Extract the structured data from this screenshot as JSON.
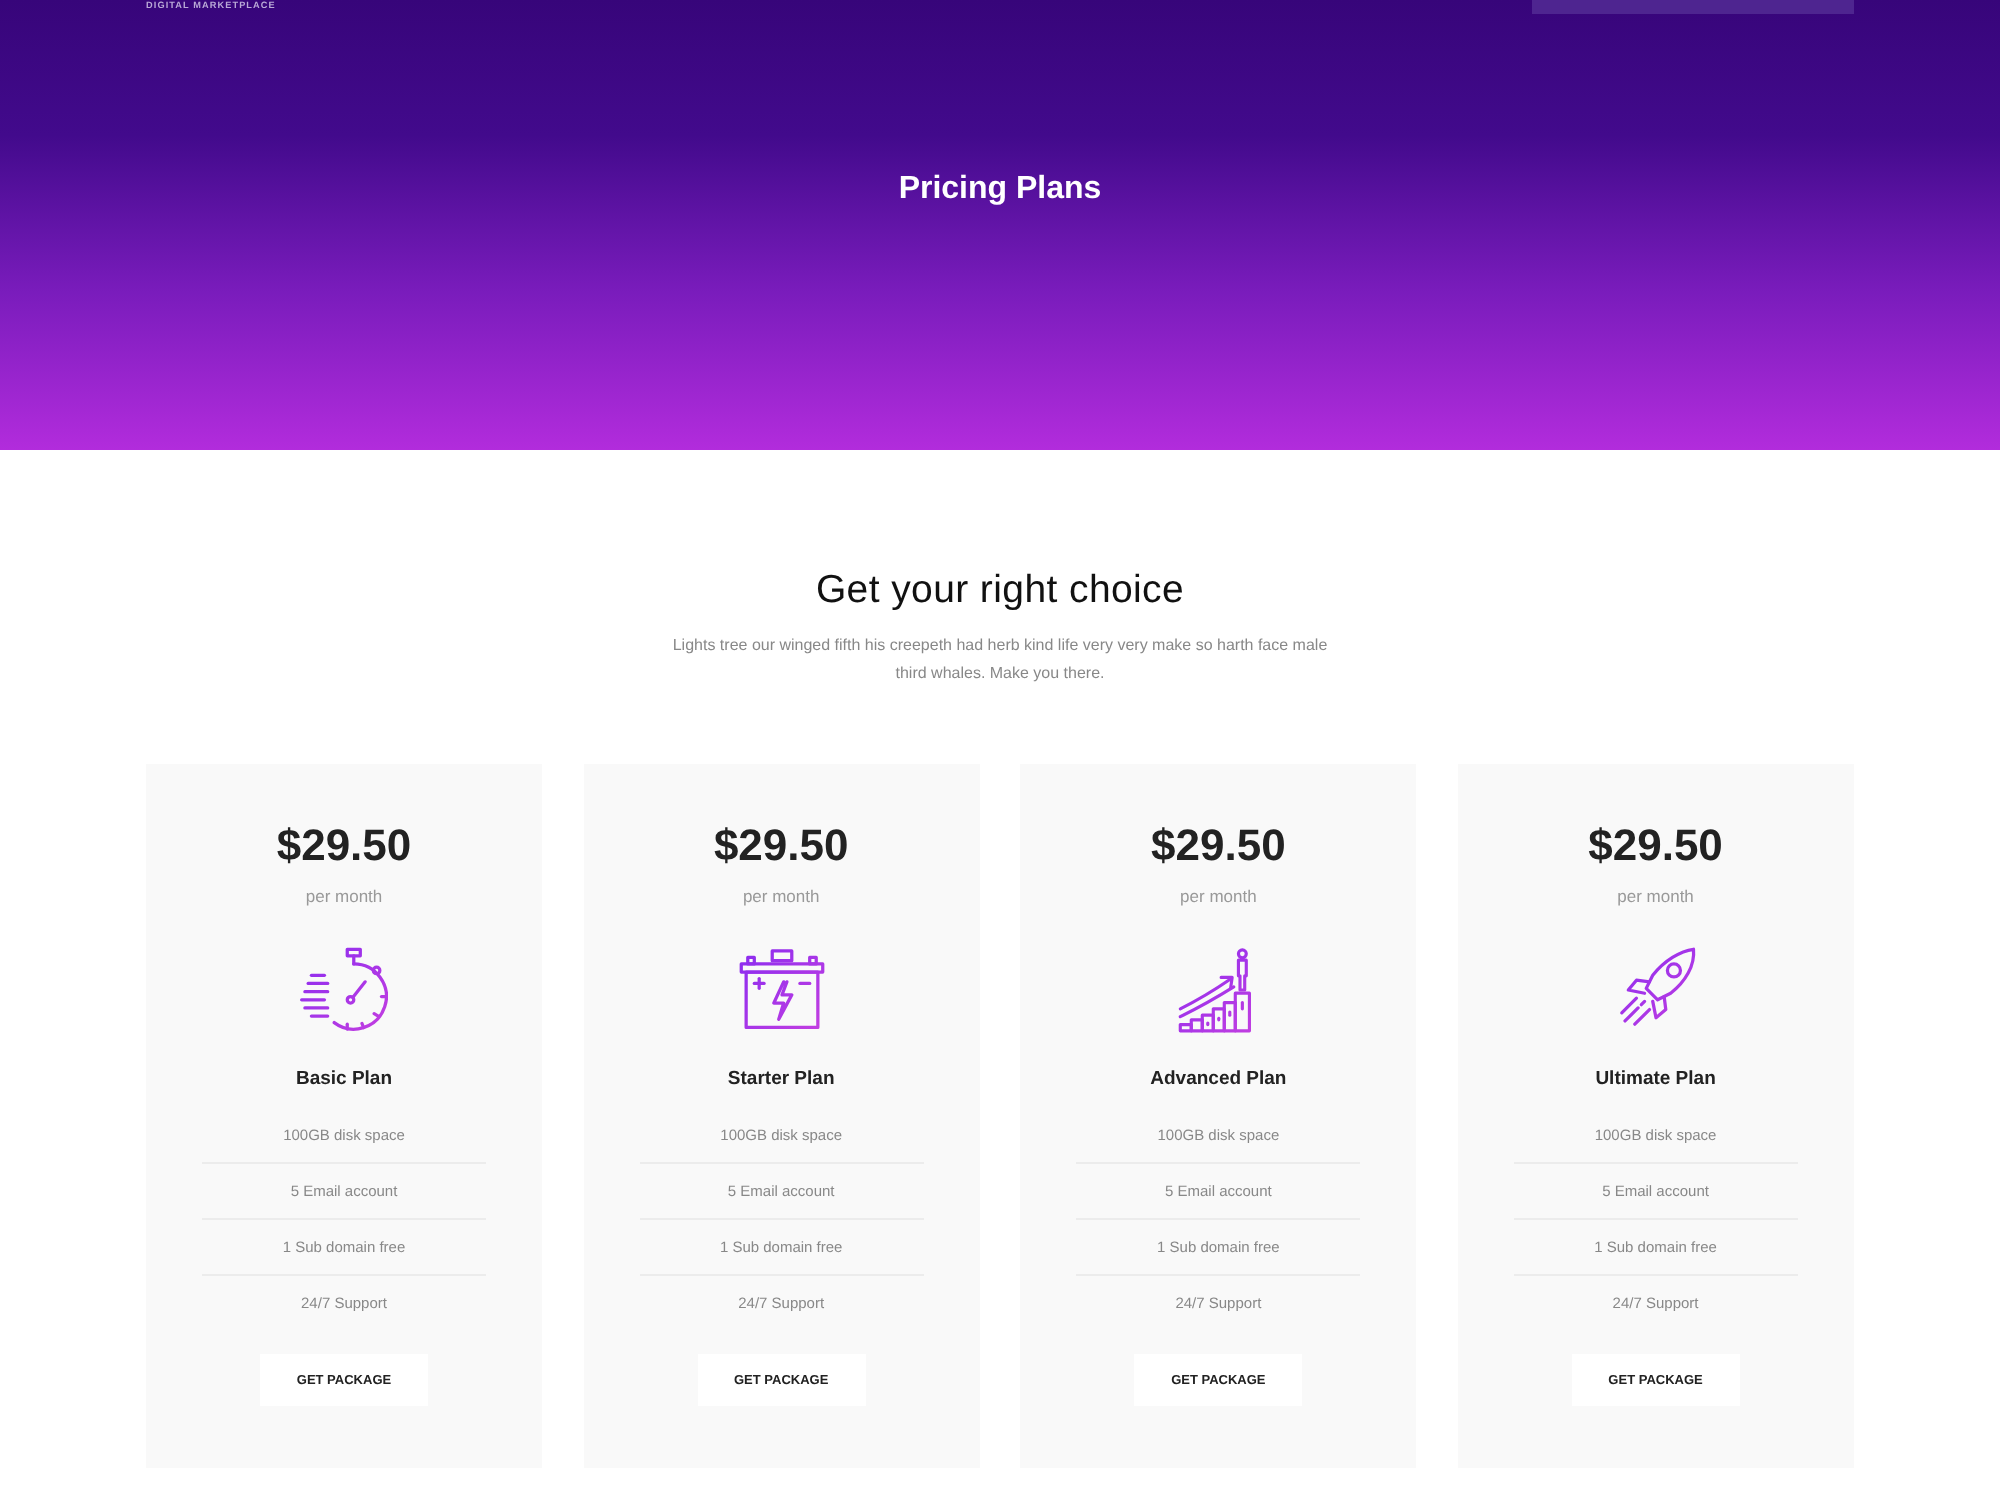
{
  "header": {
    "logo_tagline": "DIGITAL MARKETPLACE",
    "title": "Pricing Plans"
  },
  "intro": {
    "heading": "Get your right choice",
    "text": "Lights tree our winged fifth his creepeth had herb kind life very very make so harth face male third whales. Make you there."
  },
  "plans": [
    {
      "kind": "stopwatch",
      "price": "$29.50",
      "period": "per month",
      "name": "Basic Plan",
      "features": [
        "100GB disk space",
        "5 Email account",
        "1 Sub domain free",
        "24/7 Support"
      ],
      "button": "GET PACKAGE"
    },
    {
      "kind": "battery",
      "price": "$29.50",
      "period": "per month",
      "name": "Starter Plan",
      "features": [
        "100GB disk space",
        "5 Email account",
        "1 Sub domain free",
        "24/7 Support"
      ],
      "button": "GET PACKAGE"
    },
    {
      "kind": "growth",
      "price": "$29.50",
      "period": "per month",
      "name": "Advanced Plan",
      "features": [
        "100GB disk space",
        "5 Email account",
        "1 Sub domain free",
        "24/7 Support"
      ],
      "button": "GET PACKAGE"
    },
    {
      "kind": "rocket",
      "price": "$29.50",
      "period": "per month",
      "name": "Ultimate Plan",
      "features": [
        "100GB disk space",
        "5 Email account",
        "1 Sub domain free",
        "24/7 Support"
      ],
      "button": "GET PACKAGE"
    }
  ]
}
